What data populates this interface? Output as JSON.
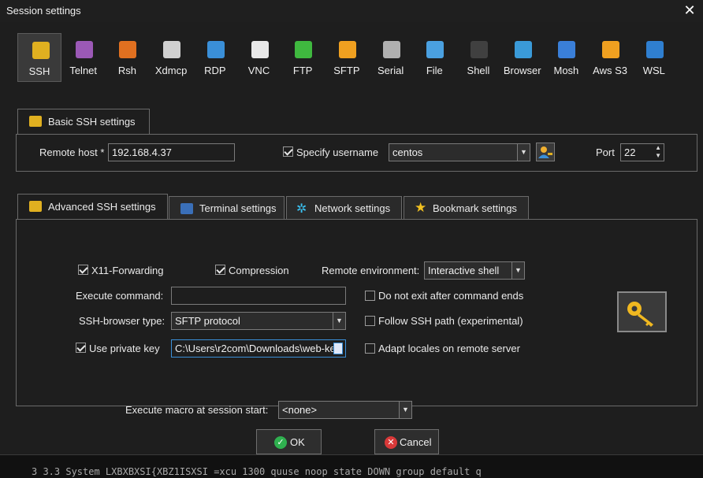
{
  "window": {
    "title": "Session settings",
    "close": "✕"
  },
  "protocols": [
    {
      "label": "SSH",
      "icon": "ssh-icon",
      "color": "#e0b020",
      "selected": true
    },
    {
      "label": "Telnet",
      "icon": "telnet-icon",
      "color": "#9b59b6"
    },
    {
      "label": "Rsh",
      "icon": "rsh-icon",
      "color": "#e07020"
    },
    {
      "label": "Xdmcp",
      "icon": "xdmcp-icon",
      "color": "#d0d0d0"
    },
    {
      "label": "RDP",
      "icon": "rdp-icon",
      "color": "#3a8fd8"
    },
    {
      "label": "VNC",
      "icon": "vnc-icon",
      "color": "#e8e8e8"
    },
    {
      "label": "FTP",
      "icon": "ftp-icon",
      "color": "#3fb83f"
    },
    {
      "label": "SFTP",
      "icon": "sftp-icon",
      "color": "#f0a020"
    },
    {
      "label": "Serial",
      "icon": "serial-icon",
      "color": "#b0b0b0"
    },
    {
      "label": "File",
      "icon": "file-icon",
      "color": "#4aa0e0"
    },
    {
      "label": "Shell",
      "icon": "shell-icon",
      "color": "#404040"
    },
    {
      "label": "Browser",
      "icon": "browser-icon",
      "color": "#3a9ad8"
    },
    {
      "label": "Mosh",
      "icon": "mosh-icon",
      "color": "#3a7fd8"
    },
    {
      "label": "Aws S3",
      "icon": "aws-s3-icon",
      "color": "#f0a020"
    },
    {
      "label": "WSL",
      "icon": "wsl-icon",
      "color": "#2f7fd0"
    }
  ],
  "basic": {
    "tab": "Basic SSH settings",
    "remote_host_label": "Remote host *",
    "remote_host": "192.168.4.37",
    "specify_username_label": "Specify username",
    "username": "centos",
    "port_label": "Port",
    "port": "22"
  },
  "tabs": [
    "Advanced SSH settings",
    "Terminal settings",
    "Network settings",
    "Bookmark settings"
  ],
  "advanced": {
    "x11_label": "X11-Forwarding",
    "compression_label": "Compression",
    "remote_env_label": "Remote environment:",
    "remote_env": "Interactive shell",
    "execute_command_label": "Execute command:",
    "execute_command": "",
    "do_not_exit_label": "Do not exit after command ends",
    "ssh_browser_label": "SSH-browser type:",
    "ssh_browser": "SFTP protocol",
    "follow_ssh_label": "Follow SSH path (experimental)",
    "private_key_label": "Use private key",
    "private_key_path": "C:\\Users\\r2com\\Downloads\\web-ke",
    "adapt_locales_label": "Adapt locales on remote server",
    "macro_label": "Execute macro at session start:",
    "macro": "<none>"
  },
  "buttons": {
    "ok": "OK",
    "cancel": "Cancel"
  },
  "background_terminal": "3  3.3 System  LXBXBXSI{XBZ1ISXSI  =xcu 1300 quuse noop state DOWN group default q"
}
